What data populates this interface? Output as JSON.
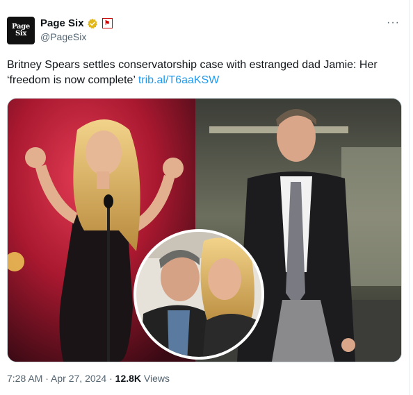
{
  "account": {
    "logo_line1": "Page",
    "logo_line2": "Six",
    "name": "Page Six",
    "handle": "@PageSix"
  },
  "tweet": {
    "text": "Britney Spears settles conservatorship case with estranged dad Jamie: Her ‘freedom is now complete’ ",
    "link": "trib.al/T6aaKSW"
  },
  "meta": {
    "time": "7:28 AM",
    "sep1": " · ",
    "date": "Apr 27, 2024",
    "sep2": " · ",
    "views_count": "12.8K",
    "views_label": " Views"
  },
  "icons": {
    "verified": "verified-badge-icon",
    "affiliate": "affiliate-badge-icon",
    "more": "more-options-icon"
  },
  "colors": {
    "link": "#1d9bf0",
    "verified": "#e2b719",
    "muted": "#536471"
  }
}
